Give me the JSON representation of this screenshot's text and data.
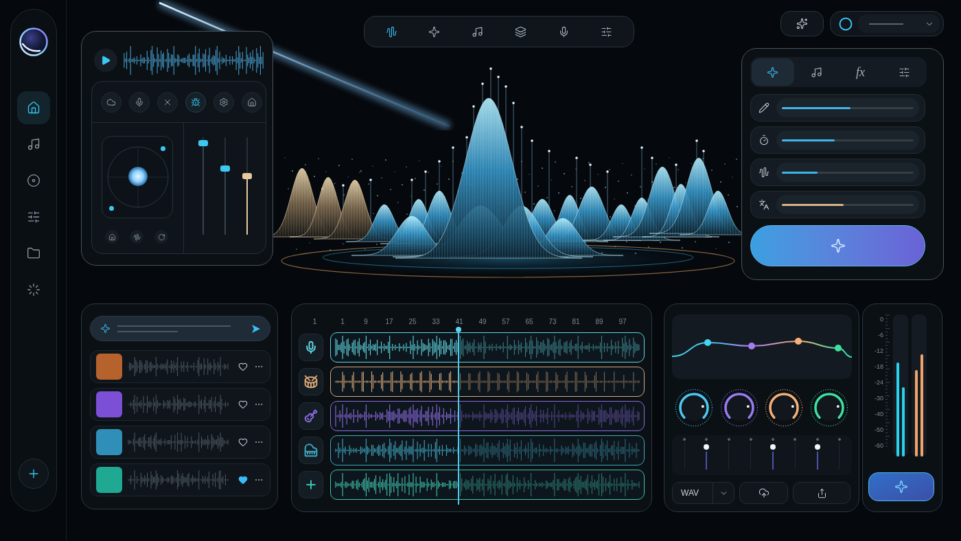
{
  "sidebar": {
    "items": [
      {
        "kind": "home",
        "selected": true
      },
      {
        "kind": "music",
        "selected": false
      },
      {
        "kind": "disc",
        "selected": false
      },
      {
        "kind": "sliders",
        "selected": false
      },
      {
        "kind": "folder",
        "selected": false
      },
      {
        "kind": "loader",
        "selected": false
      }
    ]
  },
  "player_panel": {
    "tools": [
      {
        "kind": "cloud",
        "selected": false
      },
      {
        "kind": "mic",
        "selected": false
      },
      {
        "kind": "close",
        "selected": false
      },
      {
        "kind": "bug",
        "selected": true
      },
      {
        "kind": "settings",
        "selected": false
      },
      {
        "kind": "home",
        "selected": false
      }
    ],
    "pad_tools": [
      {
        "kind": "home"
      },
      {
        "kind": "waveform"
      },
      {
        "kind": "rotate"
      }
    ],
    "faders": [
      {
        "level": 0.97,
        "color": "#3cc8f2",
        "filled": false
      },
      {
        "level": 0.69,
        "color": "#3cc8f2",
        "filled": false
      },
      {
        "level": 0.61,
        "color": "#e9c9a0",
        "filled": true
      }
    ]
  },
  "toolbar": {
    "items": [
      {
        "kind": "waveform",
        "selected": true
      },
      {
        "kind": "sparkle",
        "selected": false
      },
      {
        "kind": "music",
        "selected": false
      },
      {
        "kind": "layers",
        "selected": false
      },
      {
        "kind": "mic",
        "selected": false
      },
      {
        "kind": "sliders",
        "selected": false
      }
    ]
  },
  "controls_panel": {
    "tabs": [
      {
        "kind": "sparkle",
        "selected": true
      },
      {
        "kind": "music",
        "selected": false
      },
      {
        "kind": "text",
        "label": "fx",
        "selected": false
      },
      {
        "kind": "sliders",
        "selected": false
      }
    ],
    "sliders": [
      {
        "kind": "pencil",
        "level": 0.52,
        "color": "#3fb6f0"
      },
      {
        "kind": "timer",
        "level": 0.4,
        "color": "#3fb6f0"
      },
      {
        "kind": "waveform",
        "level": 0.27,
        "color": "#3fb6f0"
      },
      {
        "kind": "translate",
        "level": 0.47,
        "color": "#d9b48a"
      }
    ]
  },
  "library": {
    "items": [
      {
        "color": "#b5622c",
        "liked": false
      },
      {
        "color": "#7b4fd6",
        "liked": false
      },
      {
        "color": "#2f8fb8",
        "liked": false
      },
      {
        "color": "#1fa892",
        "liked": true
      }
    ]
  },
  "timeline": {
    "ruler": [
      "1",
      "1",
      "9",
      "17",
      "25",
      "33",
      "41",
      "49",
      "57",
      "65",
      "73",
      "81",
      "89",
      "97"
    ],
    "playhead": {
      "level": 0.4
    },
    "tracks": [
      {
        "kind": "mic",
        "color": "#5fd6e0"
      },
      {
        "kind": "drum",
        "color": "#d9a878"
      },
      {
        "kind": "guitar",
        "color": "#8c6be0"
      },
      {
        "kind": "piano",
        "color": "#3fa6c0"
      },
      {
        "kind": "add",
        "color": "#3fc4b0"
      }
    ]
  },
  "mixer": {
    "eq_points": [
      {
        "color": "#45d4f0"
      },
      {
        "color": "#a77cf0"
      },
      {
        "color": "#f4b27a"
      },
      {
        "color": "#3ee0a0"
      }
    ],
    "knobs": [
      {
        "color": "#4cc9f0"
      },
      {
        "color": "#9a7cf0"
      },
      {
        "color": "#f4b27a"
      },
      {
        "color": "#3ee0a0"
      }
    ],
    "faders": [
      {
        "on": false
      },
      {
        "on": true
      },
      {
        "on": false
      },
      {
        "on": false
      },
      {
        "on": true
      },
      {
        "on": false
      },
      {
        "on": true
      },
      {
        "on": false
      }
    ],
    "format": "WAV"
  },
  "meters": {
    "scale": [
      "0",
      "-6",
      "-12",
      "-18",
      "-24",
      "-30",
      "-40",
      "-50",
      "-60"
    ],
    "channels": [
      {
        "color": "#27d3ee",
        "bars": [
          {
            "level": 0.66
          },
          {
            "level": 0.49
          }
        ]
      },
      {
        "color": "#f0a46c",
        "bars": [
          {
            "level": 0.61
          },
          {
            "level": 0.72
          }
        ]
      }
    ]
  }
}
